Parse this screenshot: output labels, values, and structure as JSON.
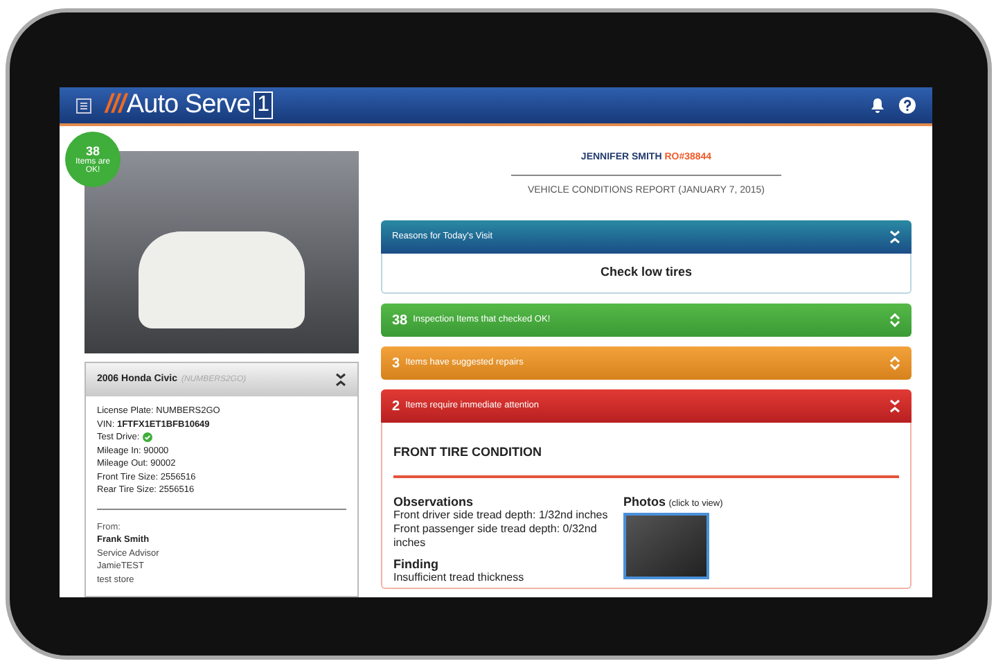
{
  "header": {
    "logo_slashes": "///",
    "logo_text": "Auto Serve",
    "logo_box": "1"
  },
  "vehicle": {
    "badge_count": "38",
    "badge_text": "Items are OK!",
    "title": "2006 Honda Civic",
    "plate_hint": "(NUMBERS2GO)",
    "expanded": true,
    "details": [
      {
        "label": "License Plate:",
        "value": "NUMBERS2GO",
        "kind": "text"
      },
      {
        "label": "VIN:",
        "value": "1FTFX1ET1BFB10649",
        "kind": "bold"
      },
      {
        "label": "Test Drive:",
        "kind": "check"
      },
      {
        "label": "Mileage In:",
        "value": "90000",
        "kind": "text"
      },
      {
        "label": "Mileage Out:",
        "value": "90002",
        "kind": "text"
      },
      {
        "label": "Front Tire Size:",
        "value": "2556516",
        "kind": "text"
      },
      {
        "label": "Rear Tire Size:",
        "value": "2556516",
        "kind": "text"
      }
    ],
    "from_label": "From:",
    "from_name": "Frank Smith",
    "from_lines": [
      "Service Advisor",
      "JamieTEST",
      "test store"
    ]
  },
  "report": {
    "customer": "JENNIFER SMITH",
    "ro": "RO#38844",
    "subtitle": "VEHICLE CONDITIONS REPORT (JANUARY 7, 2015)"
  },
  "sections": [
    {
      "kind": "reasons",
      "title": "Reasons for Today's Visit",
      "expanded": true,
      "body": "Check low tires"
    },
    {
      "kind": "ok",
      "count": "38",
      "title": "Inspection Items that checked OK!",
      "expanded": false
    },
    {
      "kind": "suggested",
      "count": "3",
      "title": "Items have suggested repairs",
      "expanded": false
    },
    {
      "kind": "urgent",
      "count": "2",
      "title": "Items require immediate attention",
      "expanded": true,
      "item": {
        "heading": "FRONT TIRE CONDITION",
        "observations_label": "Observations",
        "observations": [
          "Front driver side tread depth: 1/32nd inches",
          "Front passenger side tread depth: 0/32nd inches"
        ],
        "finding_label": "Finding",
        "finding": "Insufficient tread thickness",
        "photos_label": "Photos",
        "photos_hint": "(click to view)"
      }
    }
  ]
}
